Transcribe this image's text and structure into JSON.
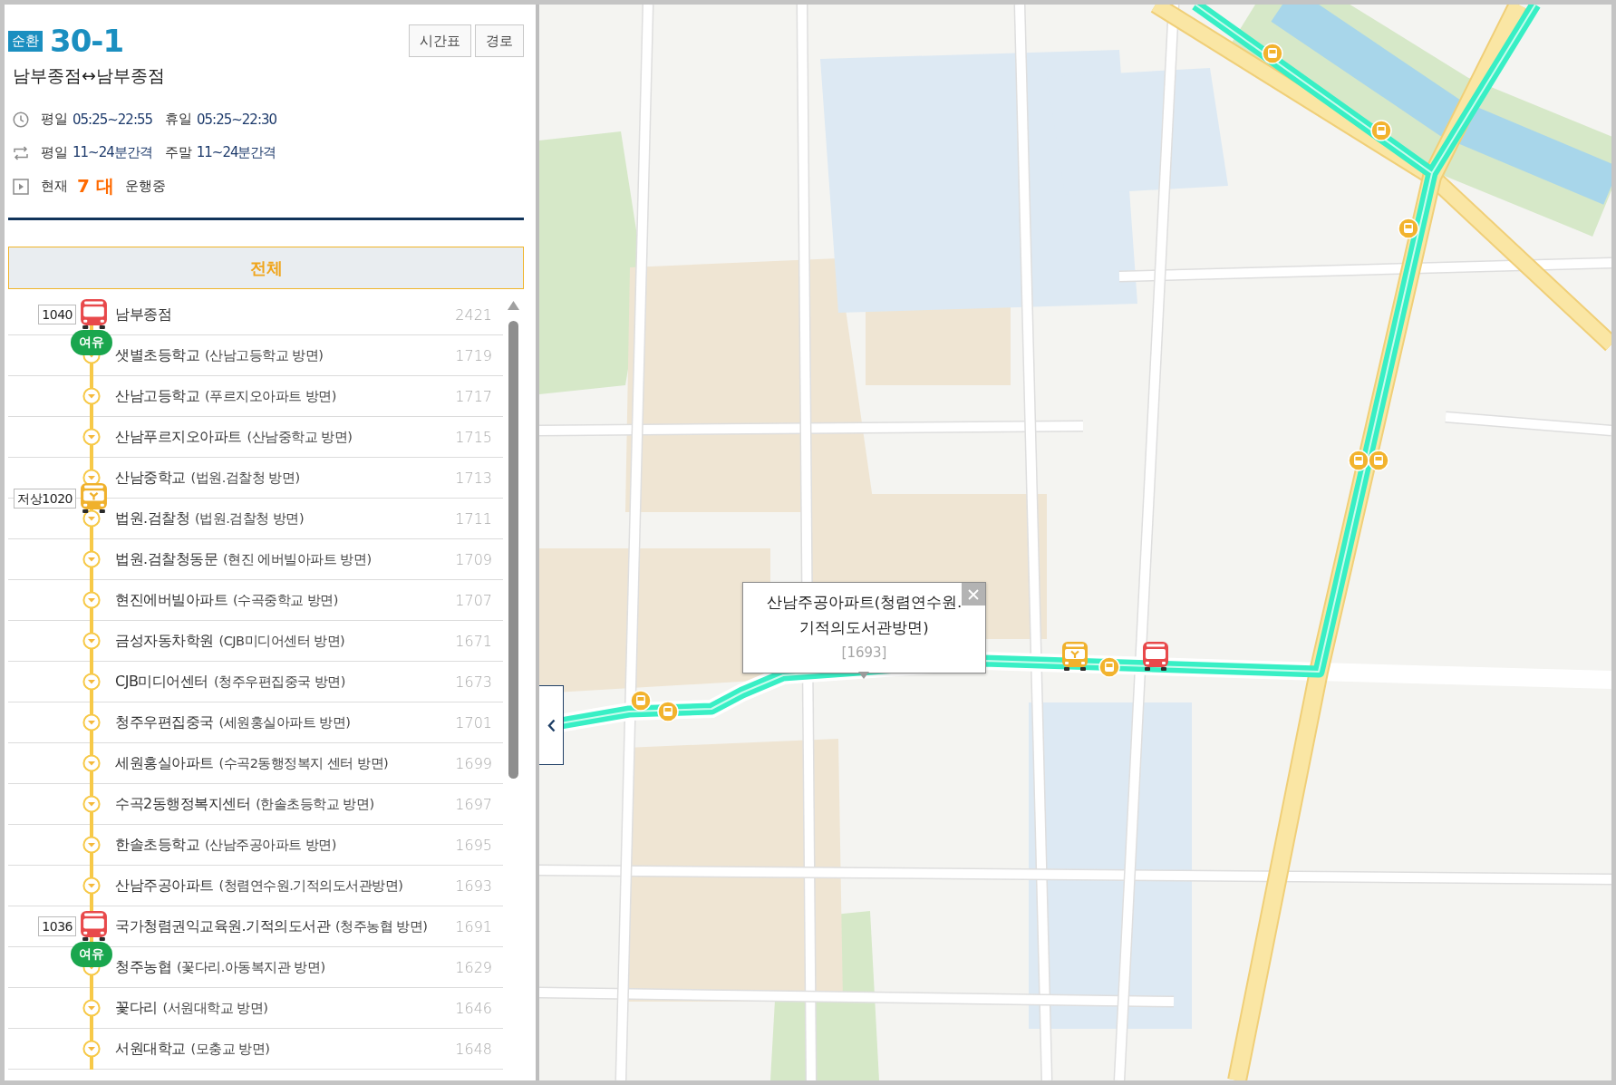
{
  "route": {
    "badge": "순환",
    "number": "30-1",
    "name": "남부종점↔남부종점",
    "actions": [
      {
        "label": "시간표"
      },
      {
        "label": "경로"
      }
    ]
  },
  "info_rows": [
    {
      "kind": "hours",
      "parts": [
        {
          "label": "평일",
          "value": "05:25~22:55"
        },
        {
          "label": "휴일",
          "value": "05:25~22:30"
        }
      ]
    },
    {
      "kind": "interval",
      "parts": [
        {
          "label": "평일",
          "value": "11~24분간격"
        },
        {
          "label": "주말",
          "value": "11~24분간격"
        }
      ]
    },
    {
      "kind": "running",
      "label": "현재",
      "count": "7 대",
      "suffix": "운행중"
    }
  ],
  "tabs": [
    {
      "label": "전체",
      "selected": true
    }
  ],
  "stops": [
    {
      "name": "남부종점",
      "id": "2421",
      "bus": {
        "number": "1040",
        "kind": "regular",
        "crowding": "여유",
        "between_stops": false
      }
    },
    {
      "name": "샛별초등학교",
      "direction": "(산남고등학교 방면)",
      "id": "1719"
    },
    {
      "name": "산남고등학교",
      "direction": "(푸르지오아파트 방면)",
      "id": "1717"
    },
    {
      "name": "산남푸르지오아파트",
      "direction": "(산남중학교 방면)",
      "id": "1715"
    },
    {
      "name": "산남중학교",
      "direction": "(법원.검찰청 방면)",
      "id": "1713",
      "bus": {
        "number": "저상1020",
        "kind": "low_floor",
        "between_stops": true
      }
    },
    {
      "name": "법원.검찰청",
      "direction": "(법원.검찰청 방면)",
      "id": "1711"
    },
    {
      "name": "법원.검찰청동문",
      "direction": "(현진 에버빌아파트 방면)",
      "id": "1709"
    },
    {
      "name": "현진에버빌아파트",
      "direction": "(수곡중학교 방면)",
      "id": "1707"
    },
    {
      "name": "금성자동차학원",
      "direction": "(CJB미디어센터 방면)",
      "id": "1671"
    },
    {
      "name": "CJB미디어센터",
      "direction": "(청주우편집중국 방면)",
      "id": "1673"
    },
    {
      "name": "청주우편집중국",
      "direction": "(세원홍실아파트 방면)",
      "id": "1701"
    },
    {
      "name": "세원홍실아파트",
      "direction": "(수곡2동행정복지 센터 방면)",
      "id": "1699"
    },
    {
      "name": "수곡2동행정복지센터",
      "direction": "(한솔초등학교 방면)",
      "id": "1697"
    },
    {
      "name": "한솔초등학교",
      "direction": "(산남주공아파트 방면)",
      "id": "1695"
    },
    {
      "name": "산남주공아파트",
      "direction": "(청렴연수원.기적의도서관방면)",
      "id": "1693"
    },
    {
      "name": "국가청렴권익교육원.기적의도서관",
      "direction": "(청주농협 방면)",
      "id": "1691",
      "bus": {
        "number": "1036",
        "kind": "regular",
        "crowding": "여유",
        "between_stops": false
      }
    },
    {
      "name": "청주농협",
      "direction": "(꽃다리.아동복지관 방면)",
      "id": "1629"
    },
    {
      "name": "꽃다리",
      "direction": "(서원대학교 방면)",
      "id": "1646"
    },
    {
      "name": "서원대학교",
      "direction": "(모충교 방면)",
      "id": "1648"
    }
  ],
  "map": {
    "popup": {
      "lines": [
        "산남주공아파트(청렴연수원.",
        "기적의도서관방면)"
      ],
      "id": "[1693]"
    },
    "buses": [
      {
        "kind": "low_floor"
      },
      {
        "kind": "regular"
      }
    ]
  }
}
